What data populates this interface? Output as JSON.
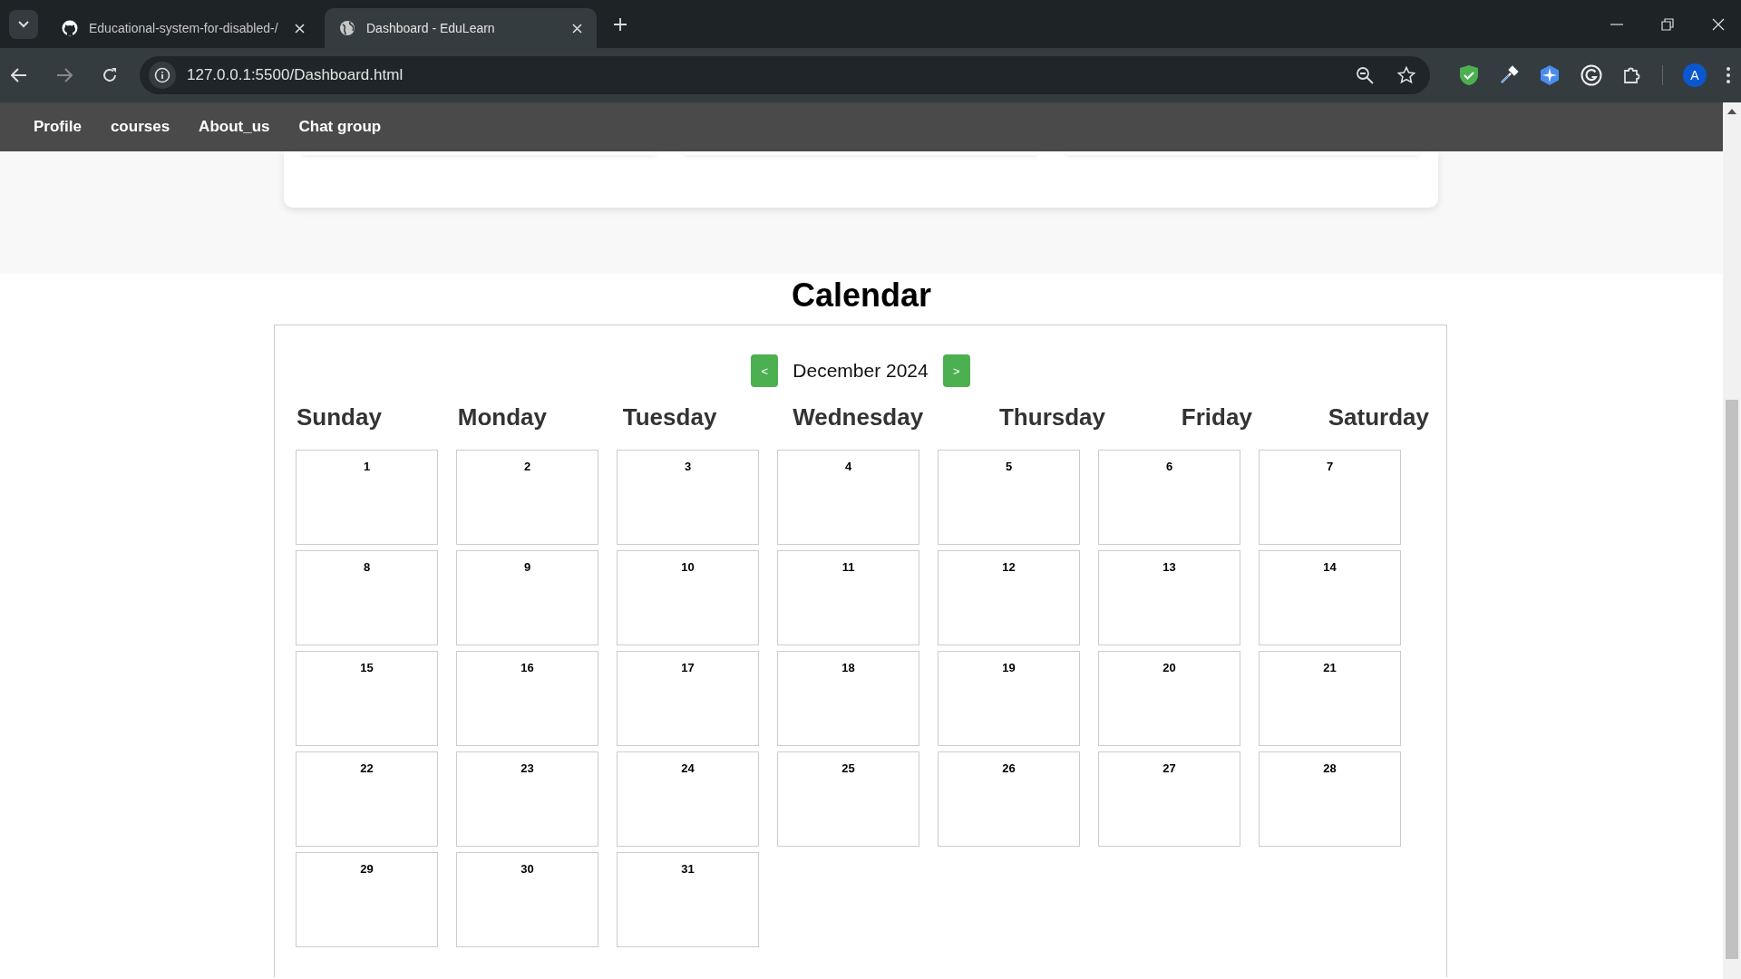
{
  "browser": {
    "tabs": [
      {
        "title": "Educational-system-for-disabled-/",
        "kind": "github",
        "selected": false
      },
      {
        "title": "Dashboard - EduLearn",
        "kind": "globe",
        "selected": true
      }
    ],
    "address": "127.0.0.1:5500/Dashboard.html",
    "profile_initial": "A"
  },
  "nav": {
    "links": [
      "Profile",
      "courses",
      "About_us",
      "Chat group"
    ]
  },
  "calendar": {
    "title": "Calendar",
    "month": "December 2024",
    "prev_button": "<",
    "next_button": ">",
    "weekdays": [
      "Sunday",
      "Monday",
      "Tuesday",
      "Wednesday",
      "Thursday",
      "Friday",
      "Saturday"
    ],
    "days": [
      "1",
      "2",
      "3",
      "4",
      "5",
      "6",
      "7",
      "8",
      "9",
      "10",
      "11",
      "12",
      "13",
      "14",
      "15",
      "16",
      "17",
      "18",
      "19",
      "20",
      "21",
      "22",
      "23",
      "24",
      "25",
      "26",
      "27",
      "28",
      "29",
      "30",
      "31"
    ]
  }
}
